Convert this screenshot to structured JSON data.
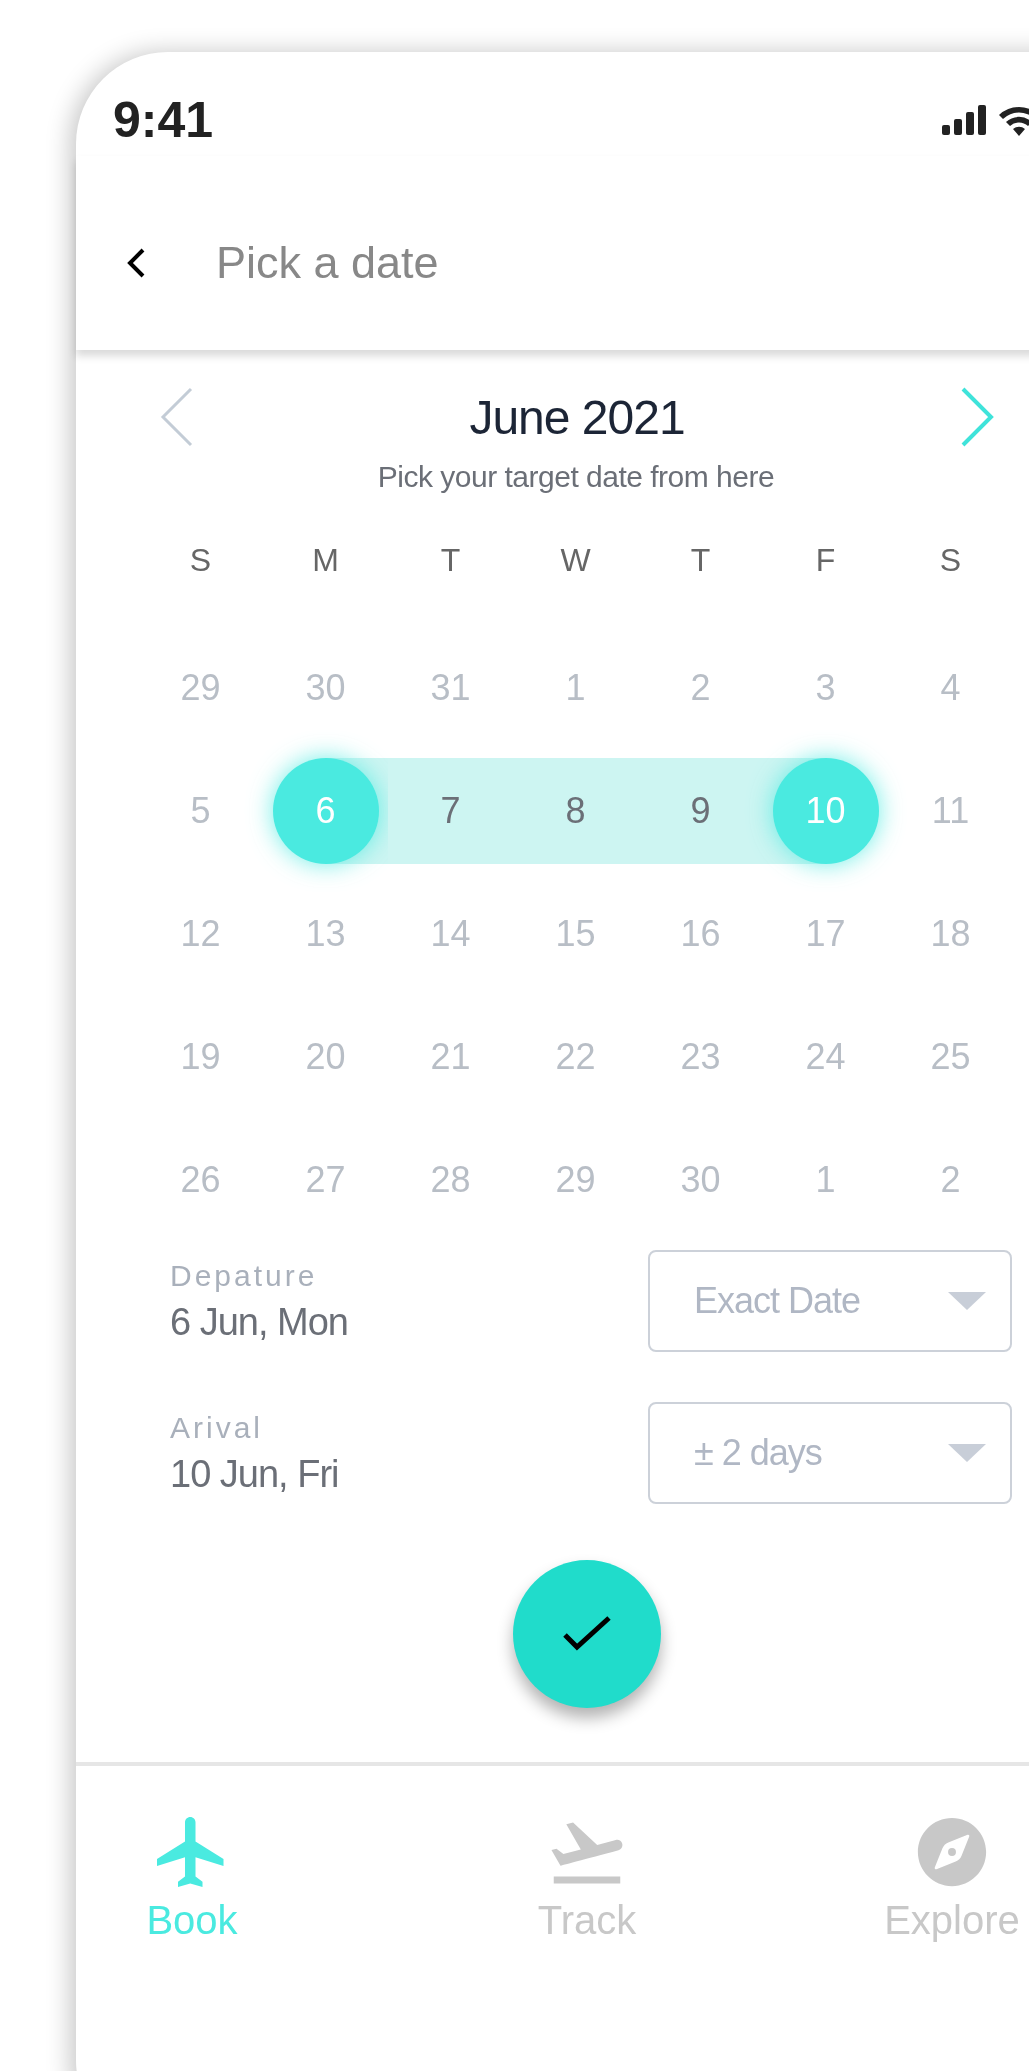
{
  "status_bar": {
    "time": "9:41"
  },
  "header": {
    "title": "Pick a date"
  },
  "calendar": {
    "month": "June 2021",
    "subtitle": "Pick your target date from here",
    "weekdays": [
      "S",
      "M",
      "T",
      "W",
      "T",
      "F",
      "S"
    ],
    "weeks": [
      [
        {
          "label": "29",
          "in_range": false,
          "selected": false
        },
        {
          "label": "30",
          "in_range": false,
          "selected": false
        },
        {
          "label": "31",
          "in_range": false,
          "selected": false
        },
        {
          "label": "1",
          "in_range": false,
          "selected": false
        },
        {
          "label": "2",
          "in_range": false,
          "selected": false
        },
        {
          "label": "3",
          "in_range": false,
          "selected": false
        },
        {
          "label": "4",
          "in_range": false,
          "selected": false
        }
      ],
      [
        {
          "label": "5",
          "in_range": false,
          "selected": false
        },
        {
          "label": "6",
          "in_range": false,
          "selected": true
        },
        {
          "label": "7",
          "in_range": true,
          "selected": false
        },
        {
          "label": "8",
          "in_range": true,
          "selected": false
        },
        {
          "label": "9",
          "in_range": true,
          "selected": false
        },
        {
          "label": "10",
          "in_range": false,
          "selected": true
        },
        {
          "label": "11",
          "in_range": false,
          "selected": false
        }
      ],
      [
        {
          "label": "12",
          "in_range": false,
          "selected": false
        },
        {
          "label": "13",
          "in_range": false,
          "selected": false
        },
        {
          "label": "14",
          "in_range": false,
          "selected": false
        },
        {
          "label": "15",
          "in_range": false,
          "selected": false
        },
        {
          "label": "16",
          "in_range": false,
          "selected": false
        },
        {
          "label": "17",
          "in_range": false,
          "selected": false
        },
        {
          "label": "18",
          "in_range": false,
          "selected": false
        }
      ],
      [
        {
          "label": "19",
          "in_range": false,
          "selected": false
        },
        {
          "label": "20",
          "in_range": false,
          "selected": false
        },
        {
          "label": "21",
          "in_range": false,
          "selected": false
        },
        {
          "label": "22",
          "in_range": false,
          "selected": false
        },
        {
          "label": "23",
          "in_range": false,
          "selected": false
        },
        {
          "label": "24",
          "in_range": false,
          "selected": false
        },
        {
          "label": "25",
          "in_range": false,
          "selected": false
        }
      ],
      [
        {
          "label": "26",
          "in_range": false,
          "selected": false
        },
        {
          "label": "27",
          "in_range": false,
          "selected": false
        },
        {
          "label": "28",
          "in_range": false,
          "selected": false
        },
        {
          "label": "29",
          "in_range": false,
          "selected": false
        },
        {
          "label": "30",
          "in_range": false,
          "selected": false
        },
        {
          "label": "1",
          "in_range": false,
          "selected": false
        },
        {
          "label": "2",
          "in_range": false,
          "selected": false
        }
      ]
    ]
  },
  "trip": [
    {
      "label": "Depature",
      "value": "6 Jun, Mon",
      "option": "Exact Date"
    },
    {
      "label": "Arival",
      "value": "10 Jun, Fri",
      "option": "± 2 days"
    }
  ],
  "tabs": [
    {
      "label": "Book",
      "kind": "plane",
      "selected": true
    },
    {
      "label": "Track",
      "kind": "takeoff",
      "selected": false
    },
    {
      "label": "Explore",
      "kind": "compass",
      "selected": false
    }
  ]
}
